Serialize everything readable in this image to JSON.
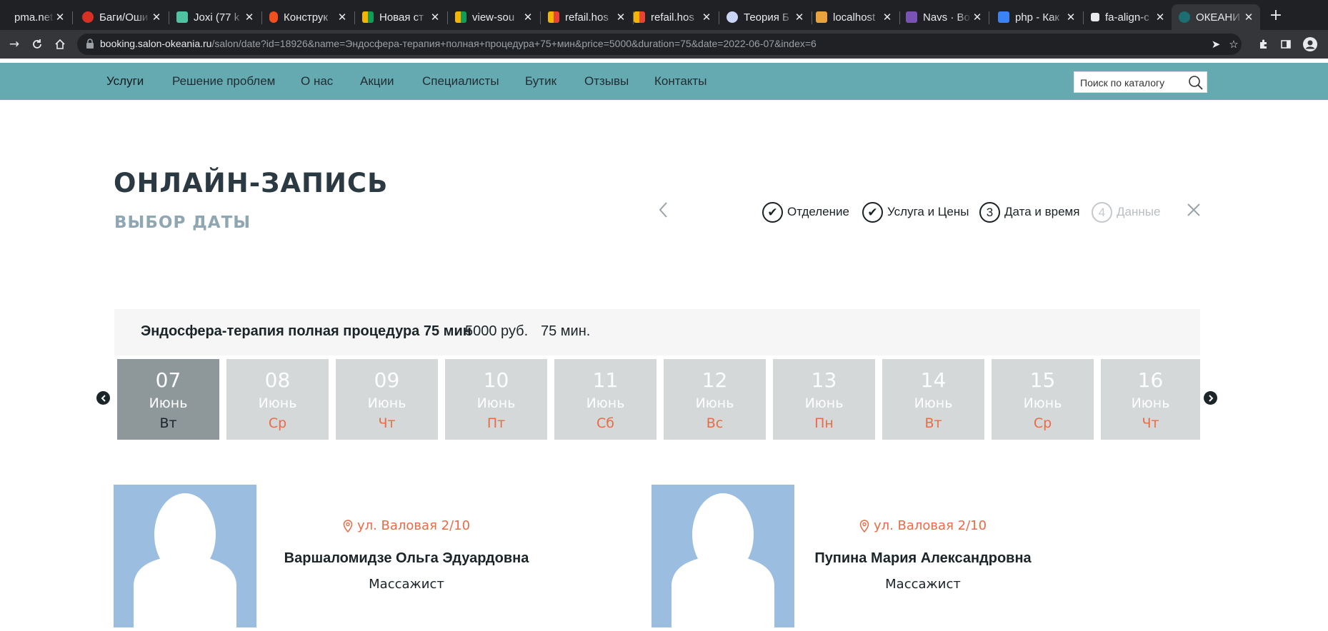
{
  "browser": {
    "tabs": [
      {
        "title": "pma.neta",
        "color": "#f29a38"
      },
      {
        "title": "Баги/Оши",
        "color": "#d93025"
      },
      {
        "title": "Joxi (77 k",
        "color": "#4fc3a1"
      },
      {
        "title": "Конструк",
        "color": "#f24e1e"
      },
      {
        "title": "Новая ст",
        "color": "#f4b400"
      },
      {
        "title": "view-sou",
        "color": "#f4b400"
      },
      {
        "title": "refail.hos",
        "color": "#f4b400"
      },
      {
        "title": "refail.hos",
        "color": "#f4b400"
      },
      {
        "title": "Теория Б",
        "color": "#8ab4f8"
      },
      {
        "title": "localhost",
        "color": "#e8a33d"
      },
      {
        "title": "Navs · Bo",
        "color": "#7952b3"
      },
      {
        "title": "php - Как",
        "color": "#3b82f6"
      },
      {
        "title": "fa-align-c",
        "color": "#e8eaed"
      },
      {
        "title": "ОКЕАНИ",
        "color": "#1b6f73"
      }
    ],
    "url_host": "booking.salon-okeania.ru",
    "url_path": "/salon/date?id=18926&name=Эндосфера-терапия+полная+процедура+75+мин&price=5000&duration=75&date=2022-06-07&index=6"
  },
  "nav": {
    "items": [
      "Услуги",
      "Решение проблем",
      "О нас",
      "Акции",
      "Специалисты",
      "Бутик",
      "Отзывы",
      "Контакты"
    ],
    "search_placeholder": "Поиск по каталогу"
  },
  "heading": {
    "title": "ОНЛАЙН-ЗАПИСЬ",
    "subtitle": "ВЫБОР ДАТЫ"
  },
  "steps": [
    {
      "mark": "✔",
      "label": "Отделение",
      "state": "done"
    },
    {
      "mark": "✔",
      "label": "Услуга и Цены",
      "state": "done"
    },
    {
      "mark": "3",
      "label": "Дата и время",
      "state": "current"
    },
    {
      "mark": "4",
      "label": "Данные",
      "state": "pending"
    }
  ],
  "service": {
    "name": "Эндосфера-терапия полная процедура 75 мин",
    "price": "5000 руб.",
    "duration": "75 мин."
  },
  "dates": [
    {
      "day": "07",
      "month": "Июнь",
      "weekday": "Вт",
      "selected": true
    },
    {
      "day": "08",
      "month": "Июнь",
      "weekday": "Ср",
      "selected": false
    },
    {
      "day": "09",
      "month": "Июнь",
      "weekday": "Чт",
      "selected": false
    },
    {
      "day": "10",
      "month": "Июнь",
      "weekday": "Пт",
      "selected": false
    },
    {
      "day": "11",
      "month": "Июнь",
      "weekday": "Сб",
      "selected": false
    },
    {
      "day": "12",
      "month": "Июнь",
      "weekday": "Вс",
      "selected": false
    },
    {
      "day": "13",
      "month": "Июнь",
      "weekday": "Пн",
      "selected": false
    },
    {
      "day": "14",
      "month": "Июнь",
      "weekday": "Вт",
      "selected": false
    },
    {
      "day": "15",
      "month": "Июнь",
      "weekday": "Ср",
      "selected": false
    },
    {
      "day": "16",
      "month": "Июнь",
      "weekday": "Чт",
      "selected": false
    }
  ],
  "specialists": [
    {
      "address": "ул. Валовая 2/10",
      "name": "Варшаломидзе Ольга Эдуардовна",
      "role": "Массажист"
    },
    {
      "address": "ул. Валовая 2/10",
      "name": "Пупина Мария Александровна",
      "role": "Массажист"
    }
  ],
  "colors": {
    "nav_bg": "#66aab1",
    "accent": "#ea6b46",
    "date_selected": "#8e989b",
    "date_default": "#d4d8d9",
    "avatar_bg": "#9bbde0"
  }
}
